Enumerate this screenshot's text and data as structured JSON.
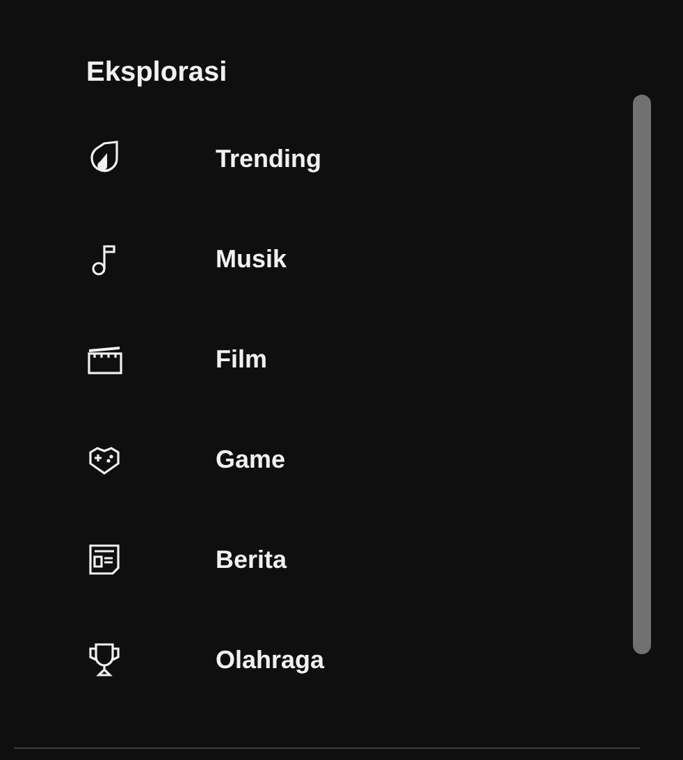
{
  "section": {
    "title": "Eksplorasi"
  },
  "items": [
    {
      "label": "Trending",
      "kind": "trending"
    },
    {
      "label": "Musik",
      "kind": "music"
    },
    {
      "label": "Film",
      "kind": "film"
    },
    {
      "label": "Game",
      "kind": "game"
    },
    {
      "label": "Berita",
      "kind": "news"
    },
    {
      "label": "Olahraga",
      "kind": "sports"
    }
  ]
}
